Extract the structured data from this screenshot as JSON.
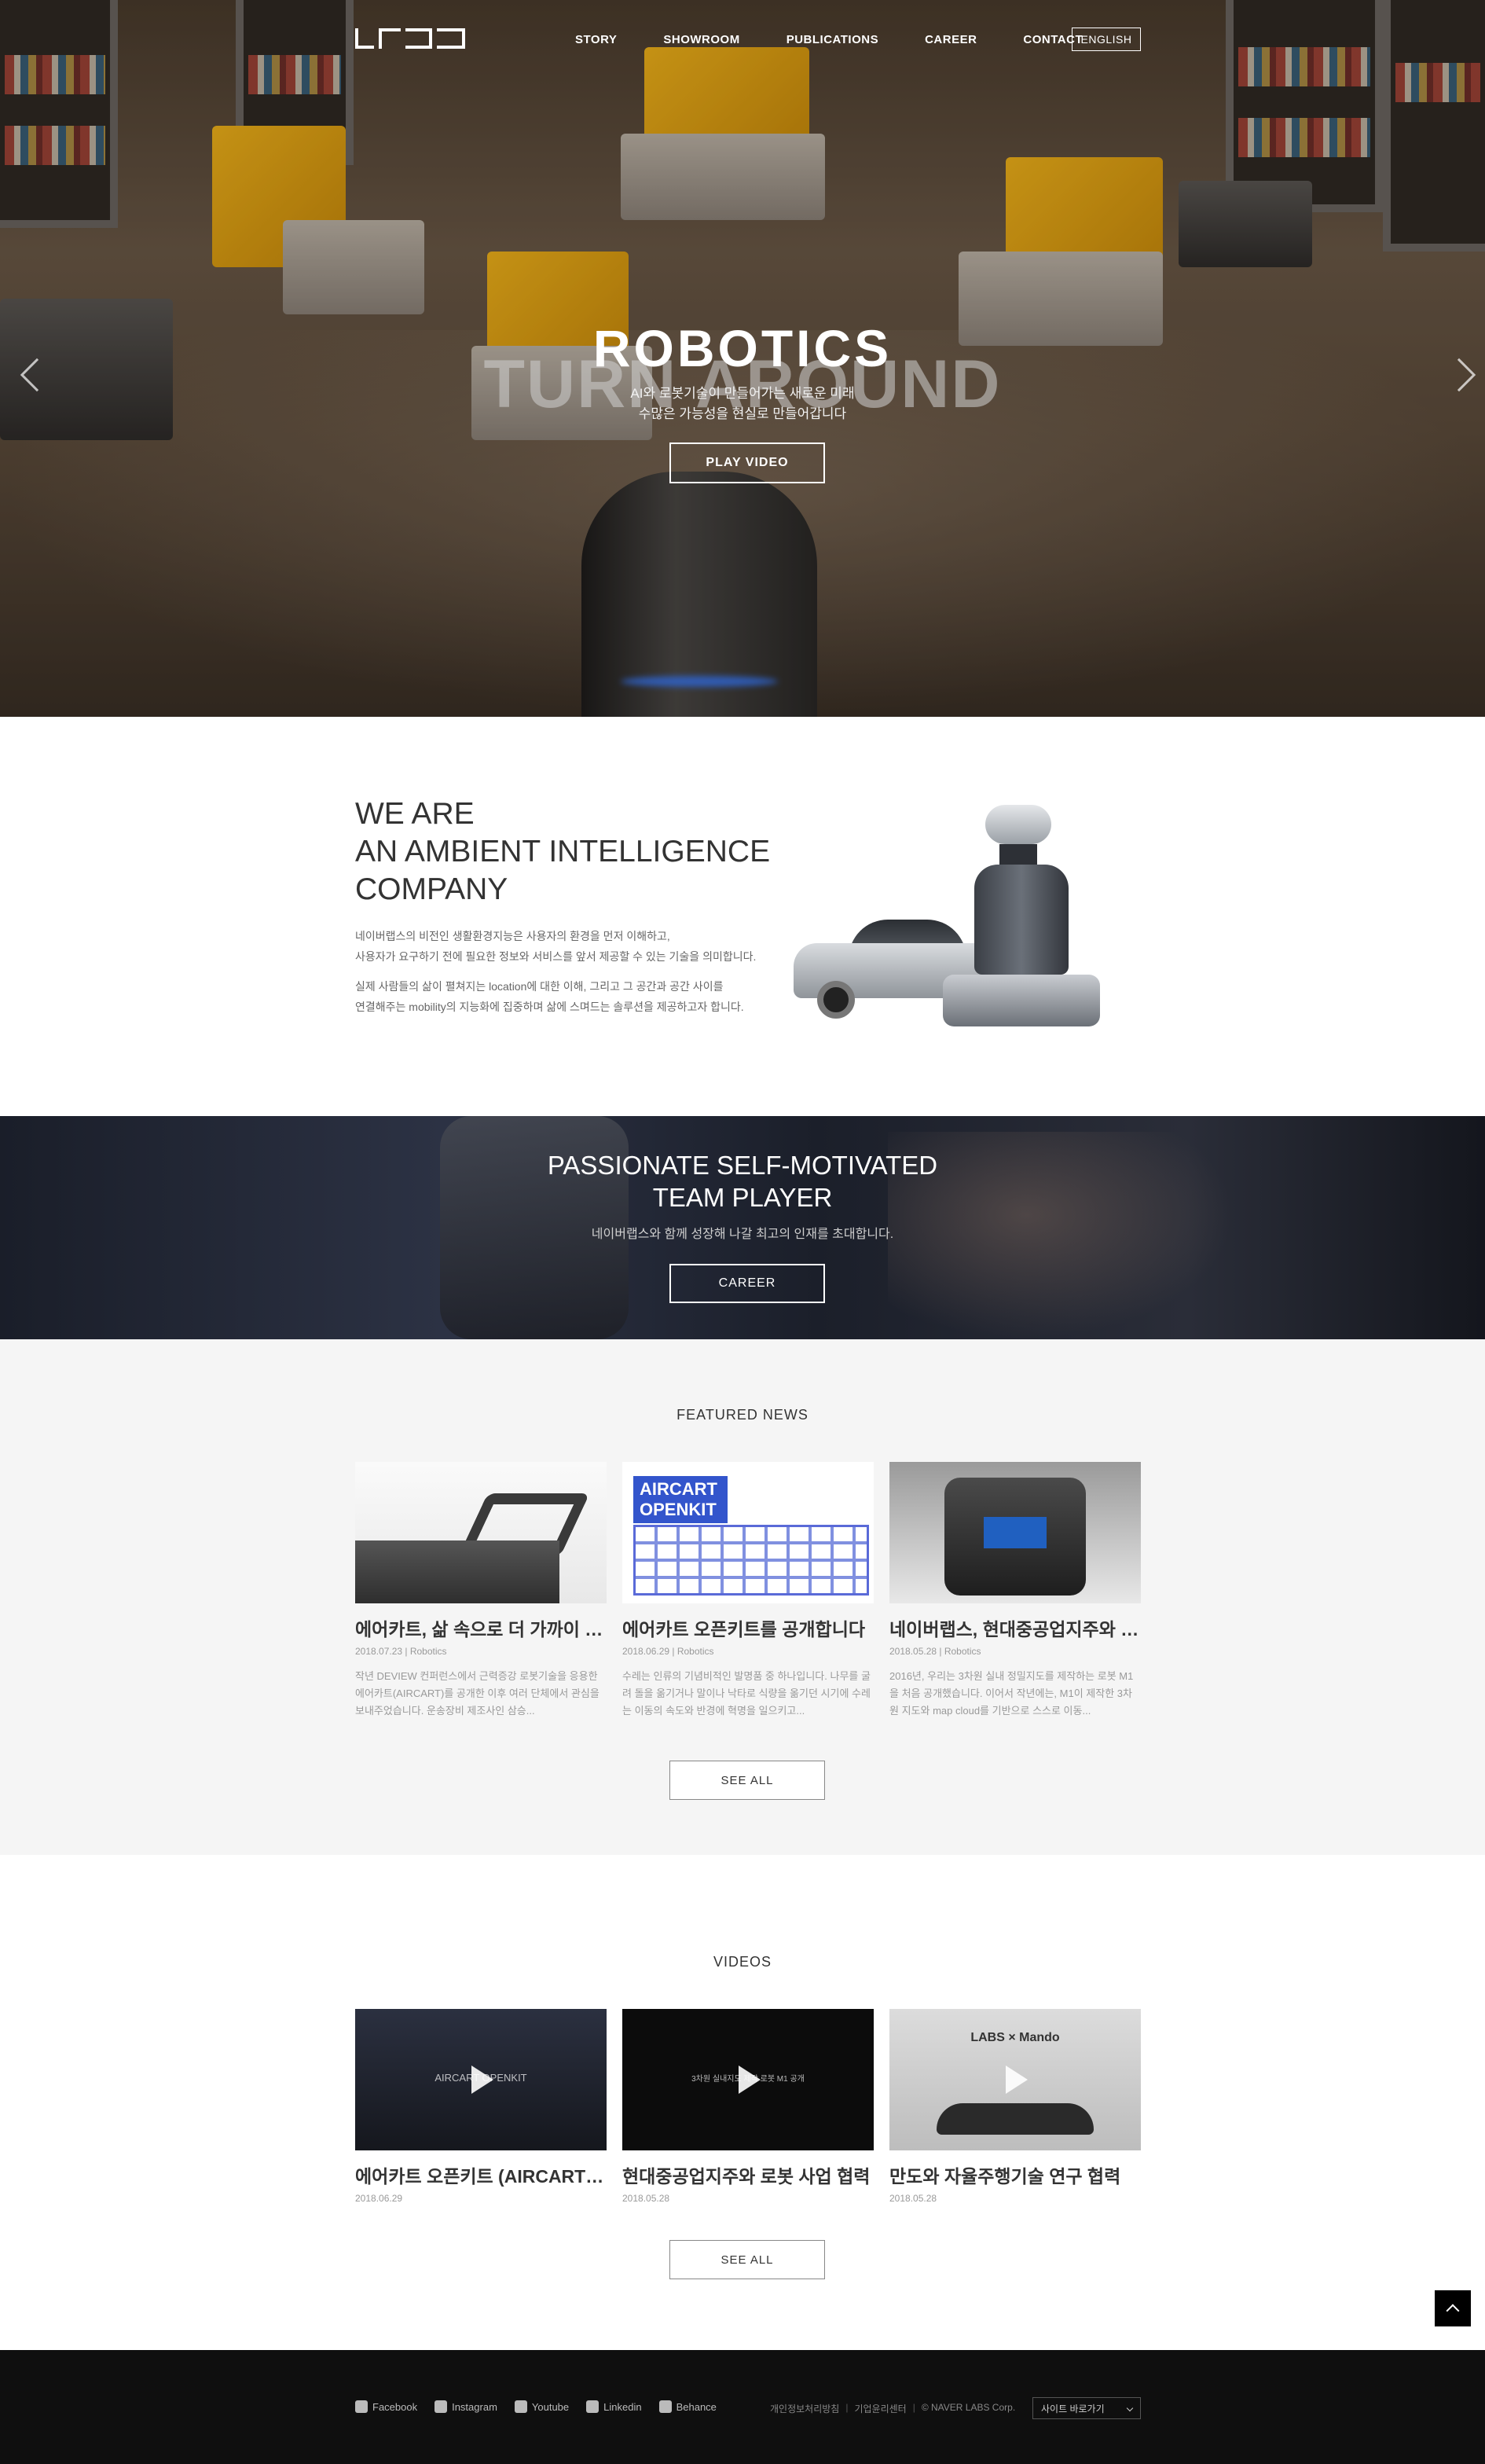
{
  "nav": {
    "items": [
      "STORY",
      "SHOWROOM",
      "PUBLICATIONS",
      "CAREER",
      "CONTACT"
    ],
    "language": "ENGLISH"
  },
  "hero": {
    "ghost_text": "TURN AROUND",
    "title": "ROBOTICS",
    "subtitle_line1": "AI와 로봇기술이 만들어가는 새로운 미래",
    "subtitle_line2": "수많은 가능성을 현실로 만들어갑니다",
    "button": "PLAY VIDEO"
  },
  "about": {
    "heading_line1": "WE ARE",
    "heading_line2": "AN AMBIENT INTELLIGENCE",
    "heading_line3": "COMPANY",
    "p1_line1": "네이버랩스의 비전인 생활환경지능은 사용자의 환경을 먼저 이해하고,",
    "p1_line2": "사용자가 요구하기 전에 필요한 정보와 서비스를 앞서 제공할 수 있는 기술을 의미합니다.",
    "p2_line1": "실제 사람들의 삶이 펼쳐지는 location에 대한 이해, 그리고 그 공간과 공간 사이를",
    "p2_line2": "연결해주는 mobility의 지능화에 집중하며 삶에 스며드는 솔루션을 제공하고자 합니다."
  },
  "career": {
    "title_line1": "PASSIONATE SELF-MOTIVATED",
    "title_line2": "TEAM PLAYER",
    "subtitle": "네이버랩스와 함께 성장해 나갈 최고의 인재를 초대합니다.",
    "button": "CAREER"
  },
  "news": {
    "heading": "FEATURED NEWS",
    "items": [
      {
        "title": "에어카트, 삶 속으로 더 가까이 - 에어카트 오픈키트",
        "meta": "2018.07.23 | Robotics",
        "desc": "작년 DEVIEW 컨퍼런스에서 근력증강 로봇기술을 응용한 에어카트(AIRCART)를 공개한 이후 여러 단체에서 관심을 보내주었습니다. 운송장비 제조사인 삼승..."
      },
      {
        "title": "에어카트 오픈키트를 공개합니다",
        "meta": "2018.06.29 | Robotics",
        "desc": "수레는 인류의 기념비적인 발명품 중 하나입니다. 나무를 굴려 돌을 옮기거나 말이나 낙타로 식량을 옮기던 시기에 수레는 이동의 속도와 반경에 혁명을 일으키고..."
      },
      {
        "title": "네이버랩스, 현대중공업지주와 로봇 사업 협력",
        "meta": "2018.05.28 | Robotics",
        "desc": "2016년, 우리는 3차원 실내 정밀지도를 제작하는 로봇 M1을 처음 공개했습니다. 이어서 작년에는, M1이 제작한 3차원 지도와 map cloud를 기반으로 스스로 이동..."
      }
    ],
    "thumb2_text": "AIRCART OPENKIT",
    "see_all": "SEE ALL"
  },
  "videos": {
    "heading": "VIDEOS",
    "items": [
      {
        "title": "에어카트 오픈키트 (AIRCART OPENKIT)",
        "date": "2018.06.29",
        "overlay": "AIRCART OPENKIT"
      },
      {
        "title": "현대중공업지주와 로봇 사업 협력",
        "date": "2018.05.28",
        "overlay": "3차원 실내지도 제작 로봇 M1 공개"
      },
      {
        "title": "만도와 자율주행기술 연구 협력",
        "date": "2018.05.28",
        "overlay": "LABS × Mando"
      }
    ],
    "see_all": "SEE ALL"
  },
  "footer": {
    "social": [
      "Facebook",
      "Instagram",
      "Youtube",
      "Linkedin",
      "Behance"
    ],
    "links": [
      "개인정보처리방침",
      "기업윤리센터",
      "© NAVER LABS Corp."
    ],
    "family_site": "사이트 바로가기"
  }
}
